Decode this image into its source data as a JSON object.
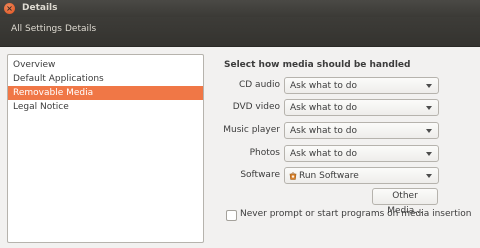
{
  "window": {
    "title": "Details"
  },
  "toolbar": {
    "all_settings_label": "All Settings",
    "details_label": "Details"
  },
  "sidebar": {
    "items": [
      {
        "label": "Overview"
      },
      {
        "label": "Default Applications"
      },
      {
        "label": "Removable Media"
      },
      {
        "label": "Legal Notice"
      }
    ],
    "selected": "Removable Media"
  },
  "main": {
    "heading": "Select how media should be handled",
    "rows": [
      {
        "label": "CD audio",
        "value": "Ask what to do"
      },
      {
        "label": "DVD video",
        "value": "Ask what to do"
      },
      {
        "label": "Music player",
        "value": "Ask what to do"
      },
      {
        "label": "Photos",
        "value": "Ask what to do"
      },
      {
        "label": "Software",
        "value": "Run Software",
        "icon": "software-center-icon"
      }
    ],
    "other_media_button": "Other Media...",
    "never_prompt_checkbox": {
      "label": "Never prompt or start programs on media insertion",
      "checked": false
    }
  },
  "colors": {
    "accent": "#f07746",
    "titlebar": "#3b3a36",
    "close_button": "#e0501c",
    "background": "#f2f1f0"
  }
}
